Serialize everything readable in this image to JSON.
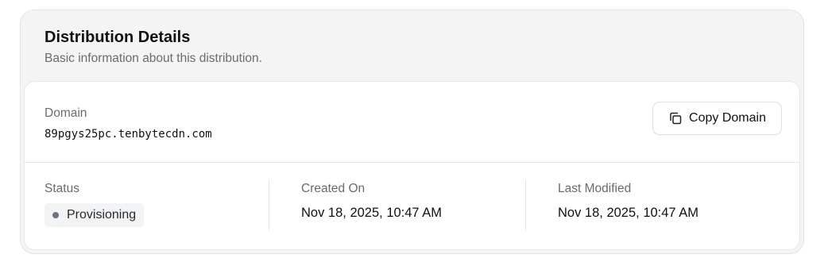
{
  "header": {
    "title": "Distribution Details",
    "subtitle": "Basic information about this distribution."
  },
  "domain": {
    "label": "Domain",
    "value": "89pgys25pc.tenbytecdn.com",
    "copy_button_label": "Copy Domain",
    "copy_icon": "copy-icon"
  },
  "status": {
    "label": "Status",
    "value": "Provisioning",
    "dot_color": "#6b7280"
  },
  "created": {
    "label": "Created On",
    "value": "Nov 18, 2025, 10:47 AM"
  },
  "modified": {
    "label": "Last Modified",
    "value": "Nov 18, 2025, 10:47 AM"
  }
}
